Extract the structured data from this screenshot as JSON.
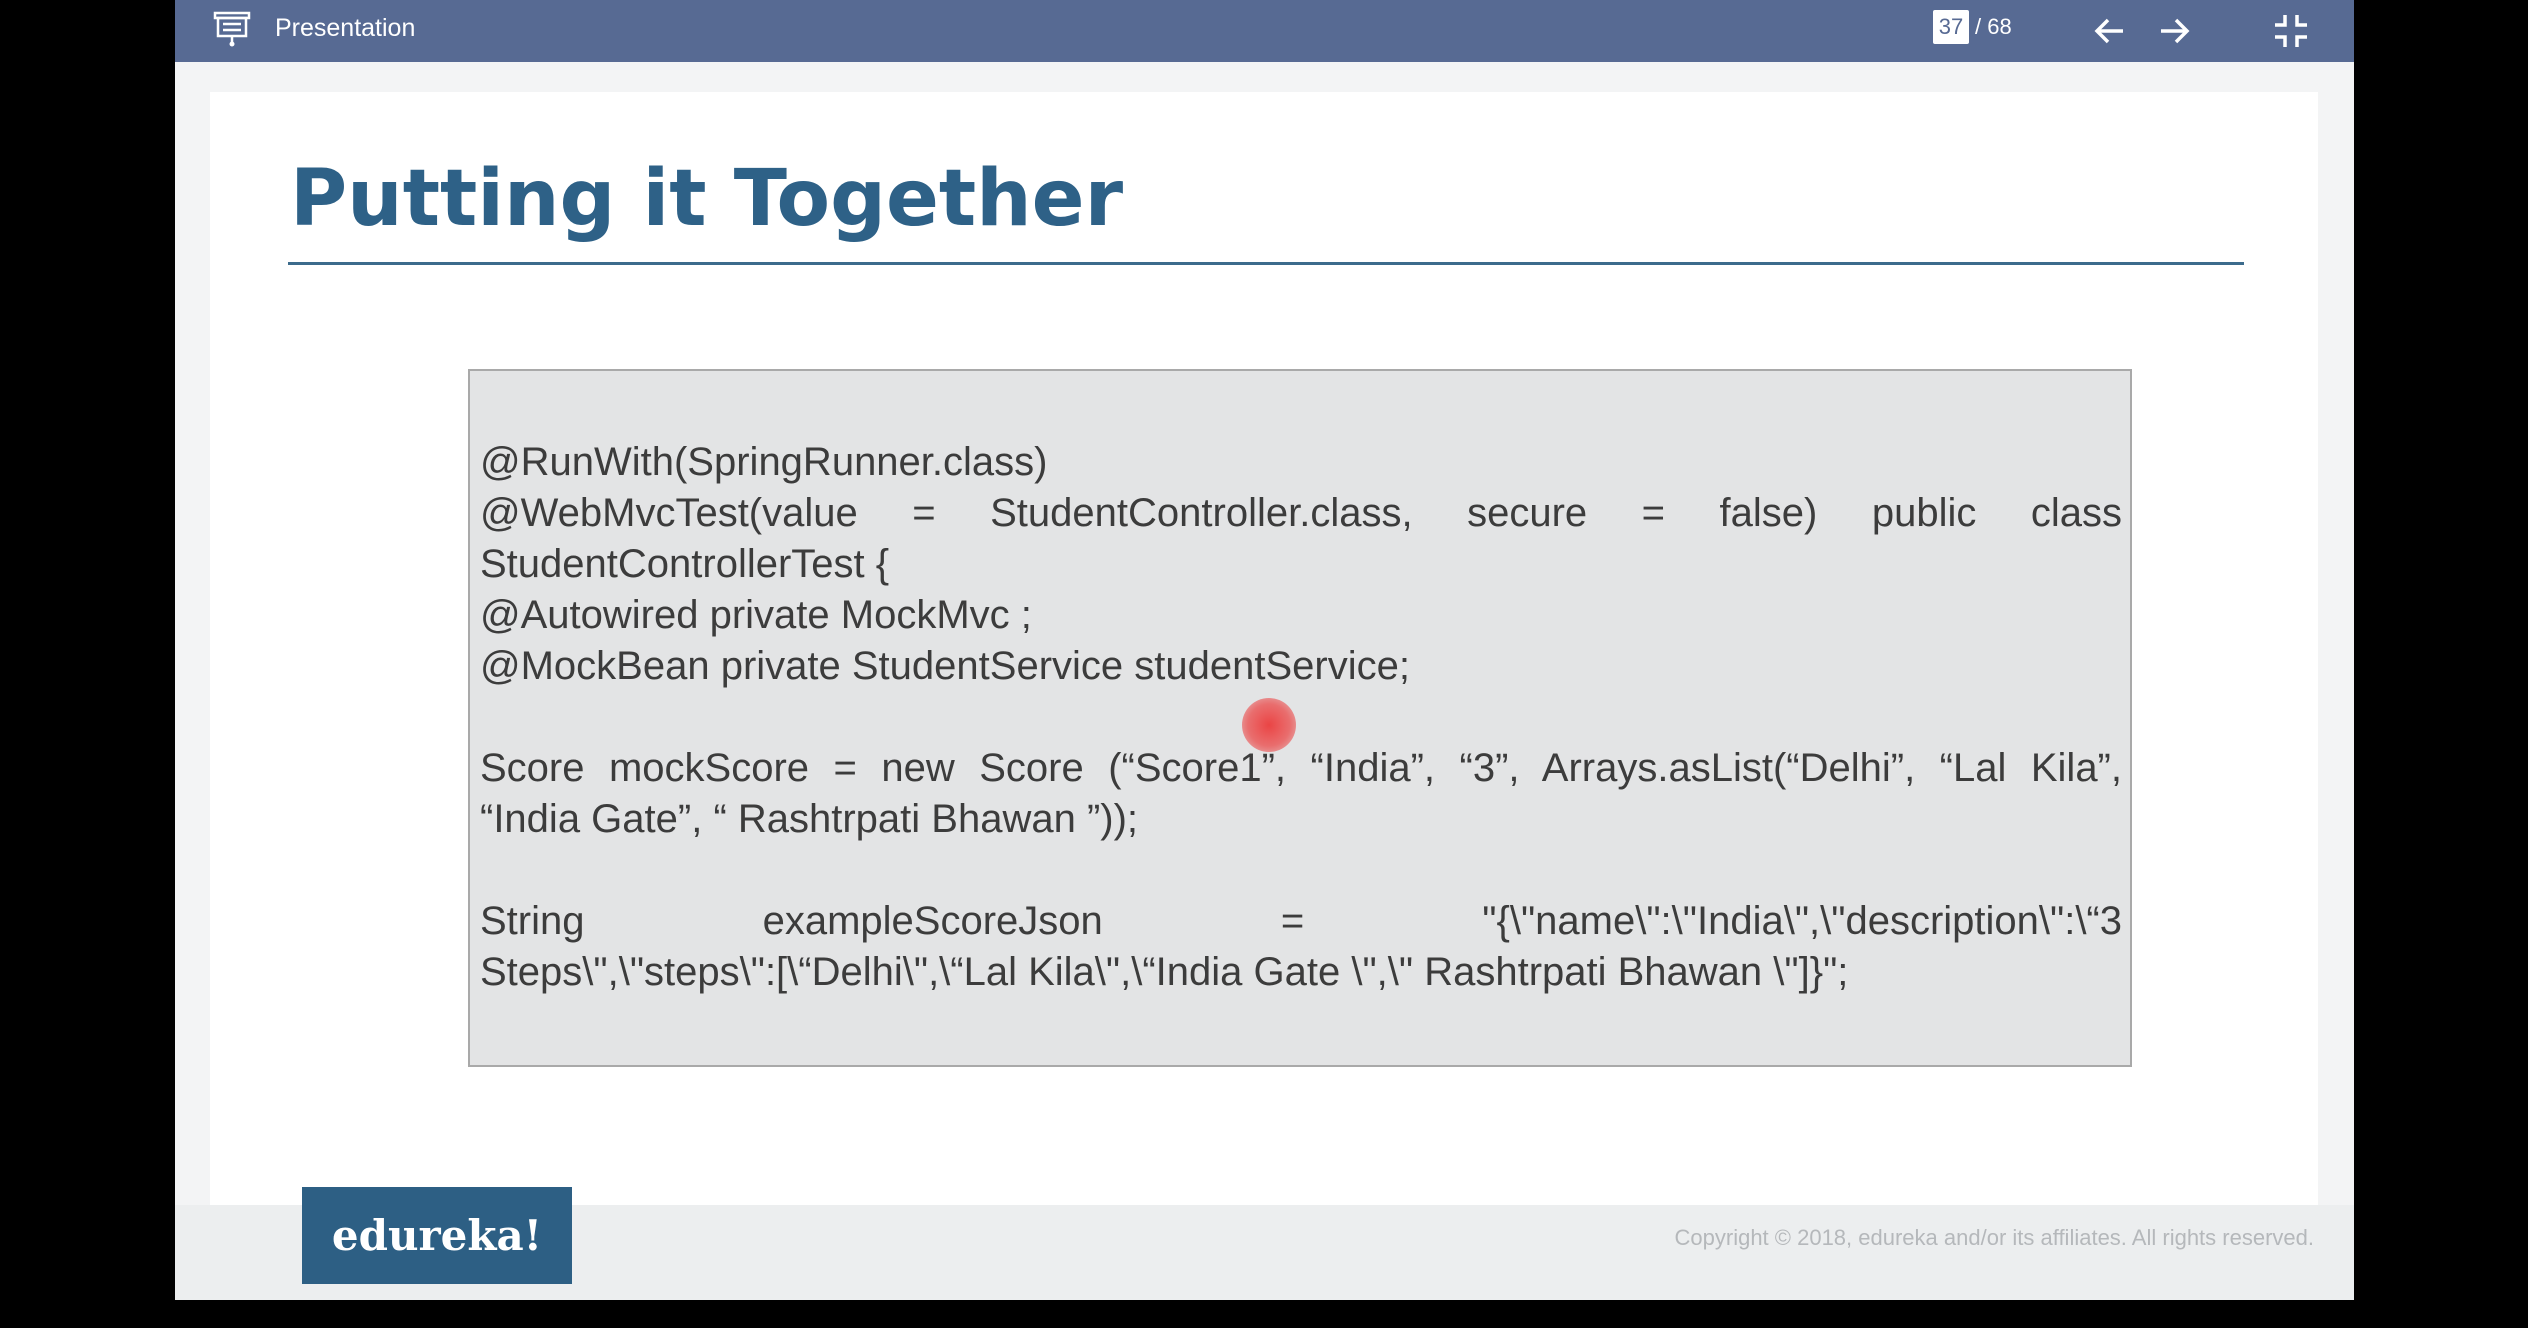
{
  "app": {
    "title": "Presentation",
    "page_current": "37",
    "page_total": "/ 68",
    "icons": {
      "presentation": "presentation-icon",
      "prev": "arrow-left-icon",
      "next": "arrow-right-icon",
      "exit": "exit-fullscreen-icon"
    },
    "colors": {
      "toolbar": "#576a93",
      "title": "#2e6187",
      "brand": "#2d5f84"
    }
  },
  "slide": {
    "title": "Putting it Together",
    "code": {
      "l1": "@RunWith(SpringRunner.class)",
      "l2": "@WebMvcTest(value = StudentController.class, secure = false) public class",
      "l3": "StudentControllerTest {",
      "l4": "@Autowired private MockMvc ;",
      "l5": "@MockBean private StudentService studentService;",
      "l6": "Score mockScore = new Score (“Score1”, “India”, “3”, Arrays.asList(“Delhi”, “Lal Kila”,",
      "l7": "“India Gate”, “ Rashtrpati Bhawan ”));",
      "l8": "String exampleScoreJson = \"{\\\"name\\\":\\\"India\\\",\\\"description\\\":\\“3",
      "l9": "Steps\\\",\\\"steps\\\":[\\“Delhi\\\",\\“Lal Kila\\\",\\“India Gate \\\",\\\" Rashtrpati Bhawan \\\"]}\";"
    },
    "brand": "edureka!",
    "copyright": "Copyright © 2018, edureka and/or its affiliates. All rights reserved."
  }
}
